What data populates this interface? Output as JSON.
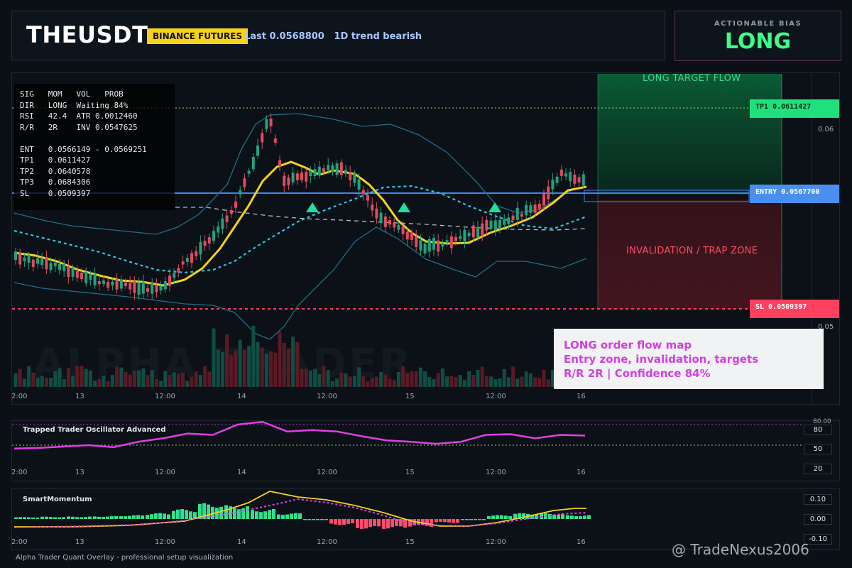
{
  "header": {
    "symbol": "THEUSDT",
    "exchange": "BINANCE FUTURES",
    "last_info": "Last 0.0568800   1D trend bearish"
  },
  "bias": {
    "title": "ACTIONABLE BIAS",
    "value": "LONG"
  },
  "info_table": {
    "rows": [
      "SIG   MOM   VOL   PROB",
      "DIR   LONG  Waiting 84%",
      "RSI   42.4  ATR 0.0012460",
      "R/R   2R    INV 0.0547625",
      "",
      "ENT   0.0566149 - 0.0569251",
      "TP1   0.0611427",
      "TP2   0.0640578",
      "TP3   0.0684306",
      "SL    0.0509397"
    ]
  },
  "levels": {
    "tp1": "TP1 0.0611427",
    "entry": "ENTRY 0.0567700",
    "sl": "SL 0.0509397"
  },
  "zones": {
    "target": "LONG TARGET FLOW",
    "invalidation": "INVALIDATION / TRAP ZONE"
  },
  "price_axis": {
    "top": "0.06",
    "bottom": "0.05"
  },
  "time_axis": [
    "2:00",
    "13",
    "12:00",
    "14",
    "12:00",
    "15",
    "12:00",
    "16"
  ],
  "annotation": {
    "line1": "LONG order flow map",
    "line2": "Entry zone, invalidation, targets",
    "line3": "R/R 2R | Confidence 84%"
  },
  "background_watermark": "ALPHA TRADER",
  "oscillator": {
    "title": "Trapped Trader Oscillator Advanced",
    "levels": [
      "80",
      "50",
      "20"
    ],
    "top_label": "80.00"
  },
  "momentum": {
    "title": "SmartMomentum",
    "levels": [
      "0.10",
      "0.00",
      "-0.10"
    ]
  },
  "footer": "Alpha Trader Quant Overlay - professional setup visualization",
  "watermark": "@ TradeNexus2006",
  "colors": {
    "bull": "#1fa27e",
    "bear": "#e04a5f",
    "ema": "#f5d21c",
    "entry": "#3f86f0",
    "tp": "#29e08a",
    "sl": "#ff3d5a",
    "band": "#1d6f8c",
    "oscillator": "#e23fe6"
  },
  "chart_data": [
    {
      "type": "line",
      "title": "Trapped Trader Oscillator Advanced",
      "ylim": [
        0,
        100
      ],
      "levels": [
        80,
        50,
        20
      ],
      "series": [
        {
          "values": [
            45,
            46,
            48,
            50,
            47,
            55,
            60,
            67,
            65,
            80,
            84,
            70,
            72,
            70,
            63,
            57,
            55,
            52,
            55,
            65,
            66,
            60,
            65,
            64
          ]
        }
      ]
    },
    {
      "type": "bar",
      "title": "SmartMomentum",
      "ylim": [
        -0.1,
        0.1
      ],
      "levels": [
        0.1,
        0.0,
        -0.1
      ],
      "values": [
        0.01,
        0.012,
        0.013,
        0.015,
        0.02,
        0.03,
        0.05,
        0.08,
        0.07,
        0.05,
        0.03,
        0.0,
        -0.03,
        -0.05,
        -0.05,
        -0.04,
        -0.02,
        0.0,
        0.02,
        0.03,
        0.03,
        0.02
      ]
    }
  ]
}
